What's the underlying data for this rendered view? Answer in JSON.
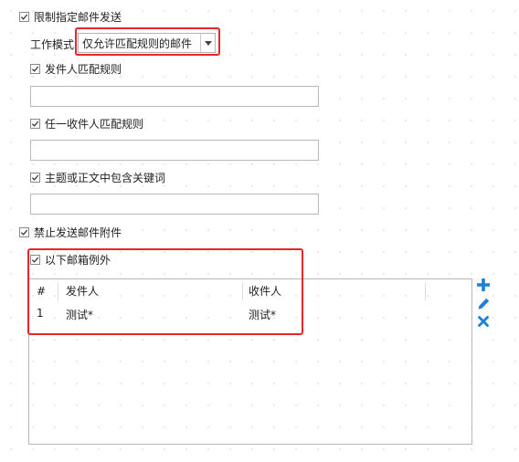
{
  "restrict_send": {
    "label": "限制指定邮件发送",
    "checked": true
  },
  "work_mode": {
    "label": "工作模式",
    "selected": "仅允许匹配规则的邮件"
  },
  "sender_rule": {
    "label": "发件人匹配规则",
    "checked": true,
    "value": ""
  },
  "recipient_rule": {
    "label": "任一收件人匹配规则",
    "checked": true,
    "value": ""
  },
  "keyword_rule": {
    "label": "主题或正文中包含关键词",
    "checked": true,
    "value": ""
  },
  "block_attach": {
    "label": "禁止发送邮件附件",
    "checked": true
  },
  "exceptions": {
    "label": "以下邮箱例外",
    "checked": true,
    "columns": [
      "#",
      "发件人",
      "收件人"
    ],
    "rows": [
      {
        "num": "1",
        "sender": "测试*",
        "recipient": "测试*"
      }
    ]
  },
  "toolbar": {
    "add_icon": "plus-icon",
    "edit_icon": "pencil-icon",
    "delete_icon": "x-icon",
    "accent_color": "#1d7fd6"
  },
  "highlight_color": "#e8262a"
}
